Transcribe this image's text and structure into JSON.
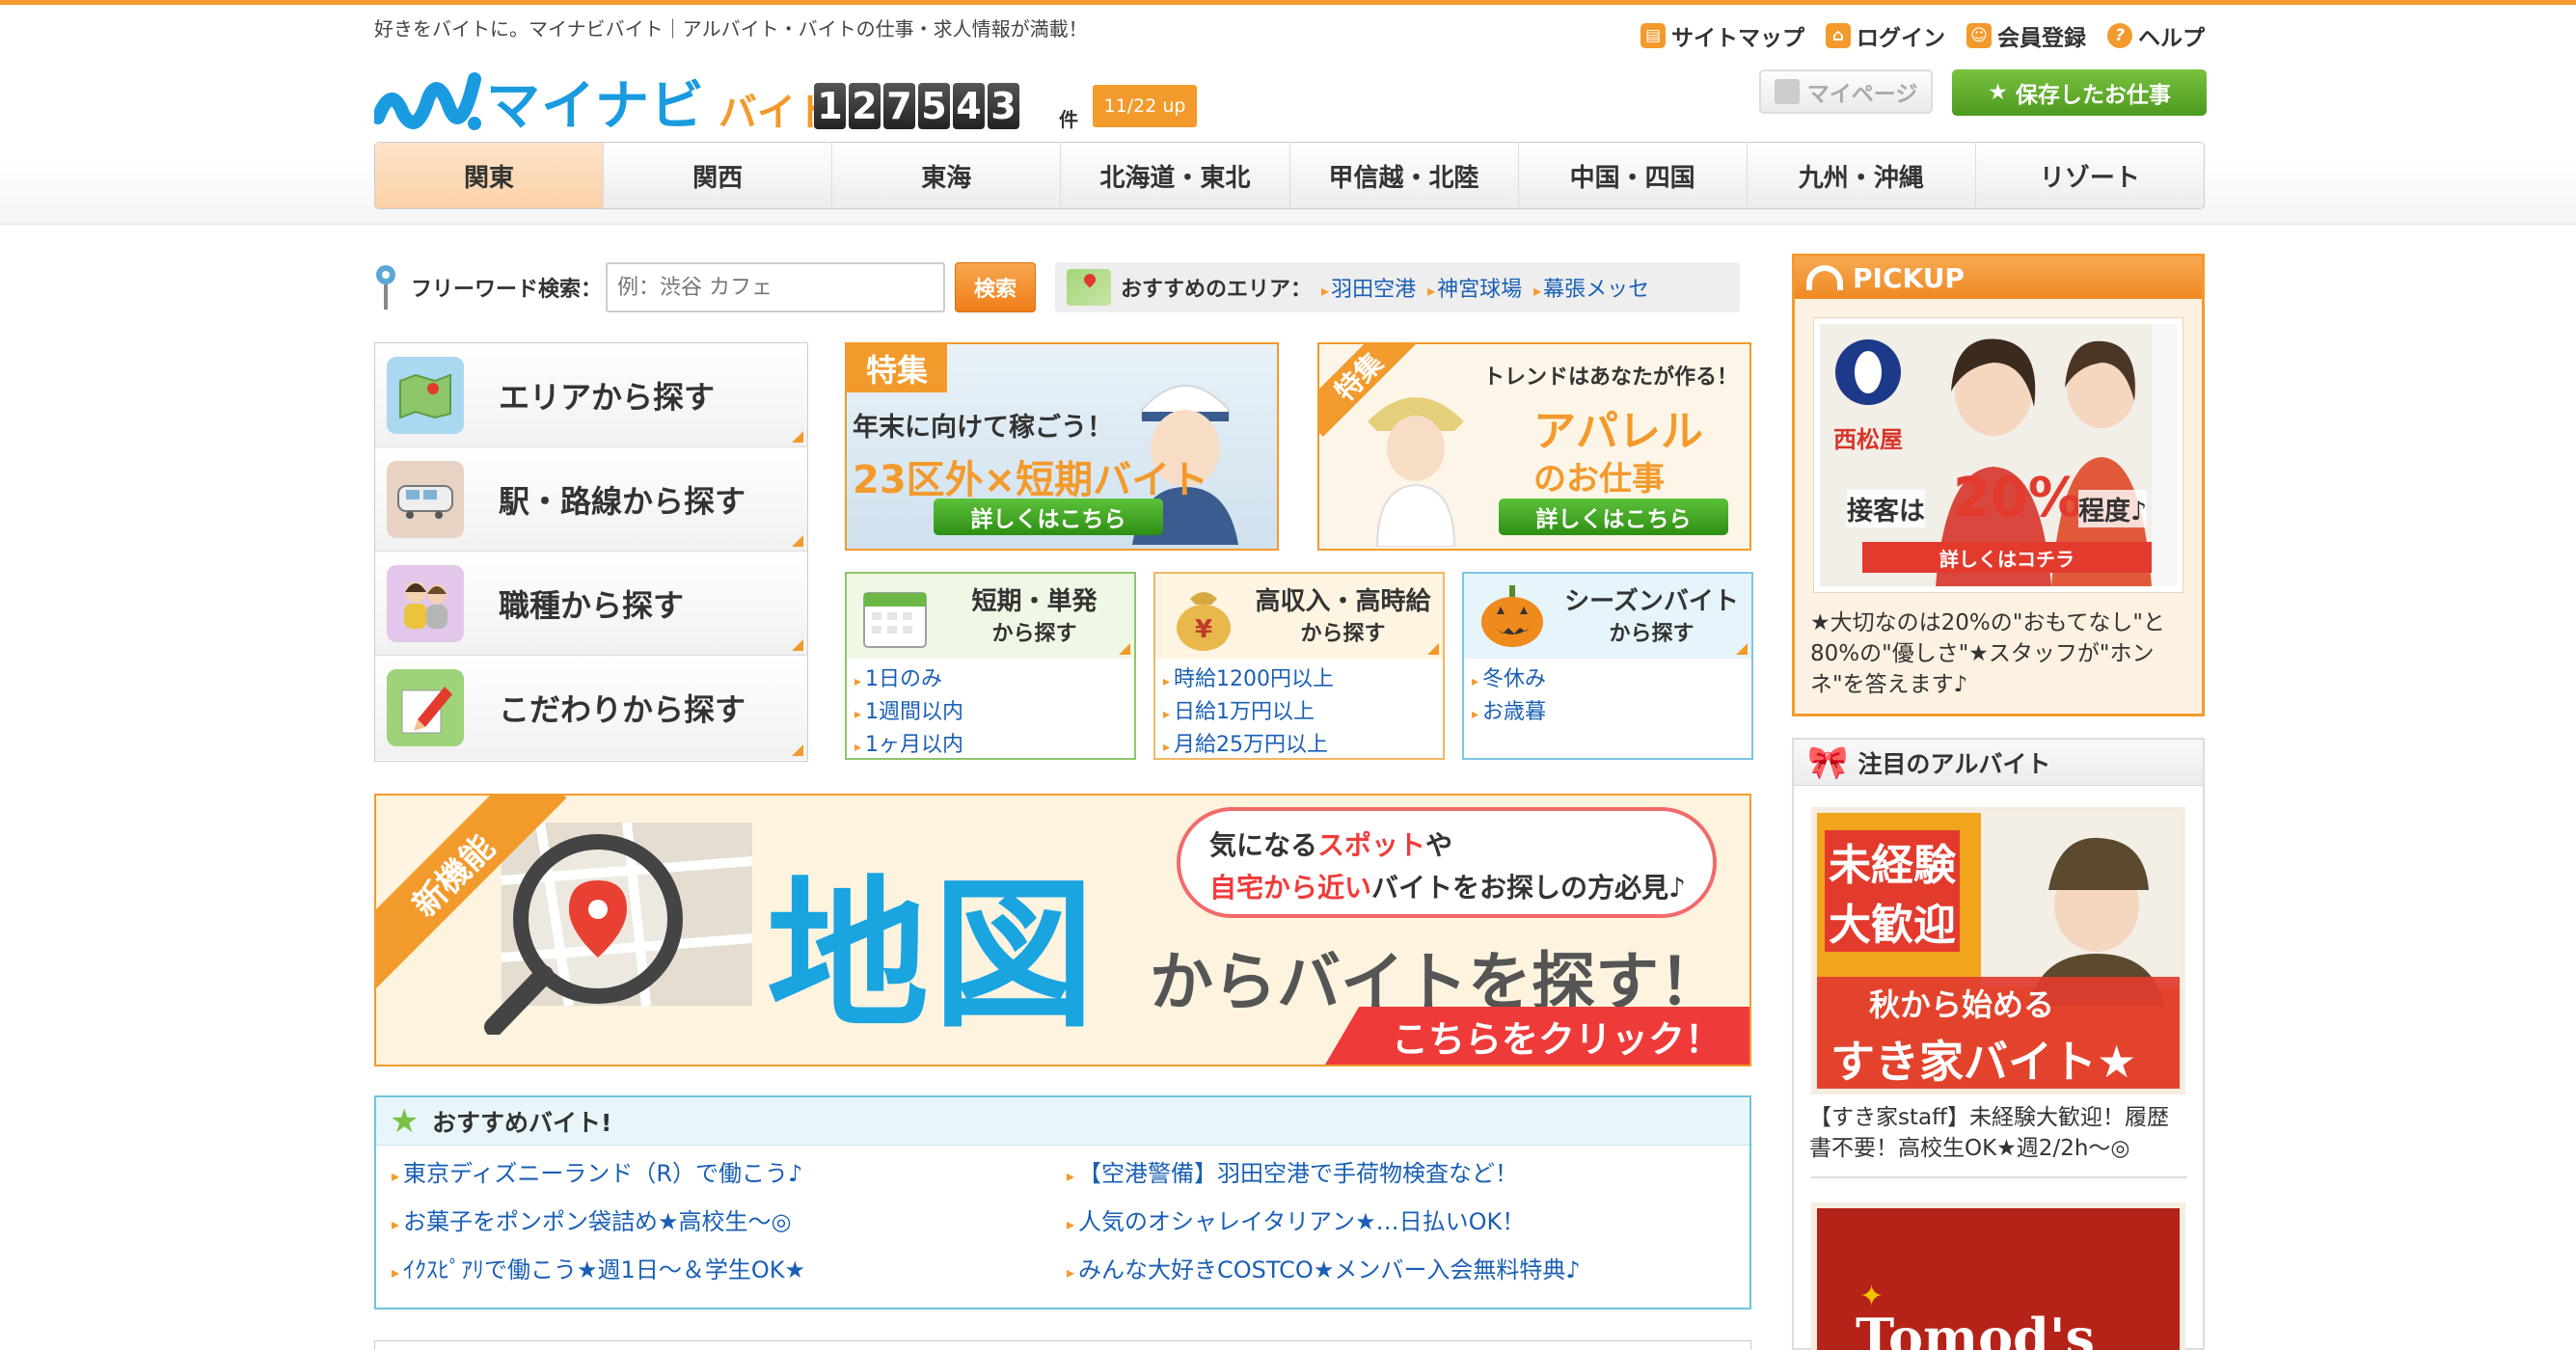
{
  "header": {
    "tagline": "好きをバイトに。マイナビバイト｜アルバイト・バイトの仕事・求人情報が満載！",
    "links": [
      {
        "label": "サイトマップ",
        "icon": "sitemap-icon"
      },
      {
        "label": "ログイン",
        "icon": "lock-icon"
      },
      {
        "label": "会員登録",
        "icon": "user-icon"
      },
      {
        "label": "ヘルプ",
        "icon": "help-icon"
      }
    ],
    "logo_text": "マイナビ",
    "logo_sub": "バイト",
    "count_digits": [
      "1",
      "2",
      "7",
      "5",
      "4",
      "3"
    ],
    "count_unit": "件",
    "update_badge": "11/22 up",
    "mypage_label": "マイページ",
    "saved_label": "保存したお仕事",
    "colors": {
      "accent": "#f39a2c",
      "brand_blue": "#1a9be0",
      "green": "#5cb82f"
    }
  },
  "nav": {
    "regions": [
      "関東",
      "関西",
      "東海",
      "北海道・東北",
      "甲信越・北陸",
      "中国・四国",
      "九州・沖縄",
      "リゾート"
    ],
    "active": "関東"
  },
  "search": {
    "label": "フリーワード検索：",
    "placeholder": "例：渋谷 カフェ",
    "button": "検索",
    "rec_label": "おすすめのエリア：",
    "rec_areas": [
      "羽田空港",
      "神宮球場",
      "幕張メッセ"
    ]
  },
  "finder": [
    {
      "label": "エリアから探す",
      "icon": "map-icon"
    },
    {
      "label": "駅・路線から探す",
      "icon": "train-icon"
    },
    {
      "label": "職種から探す",
      "icon": "people-icon"
    },
    {
      "label": "こだわりから探す",
      "icon": "pen-icon"
    }
  ],
  "tokushu": {
    "tag": "特集",
    "sub": "年末に向けて稼ごう！",
    "main": "23区外×短期バイト",
    "button": "詳しくはこちら"
  },
  "apparel": {
    "tag": "特集",
    "trend": "トレンドはあなたが作る！",
    "main": "アパレル",
    "main2": "のお仕事",
    "button": "詳しくはこちら"
  },
  "categories": [
    {
      "title": "短期・単発",
      "subtitle": "から探す",
      "icon": "calendar-icon",
      "items": [
        "1日のみ",
        "1週間以内",
        "1ヶ月以内"
      ]
    },
    {
      "title": "高収入・高時給",
      "subtitle": "から探す",
      "icon": "money-bag-icon",
      "items": [
        "時給1200円以上",
        "日給1万円以上",
        "月給25万円以上"
      ]
    },
    {
      "title": "シーズンバイト",
      "subtitle": "から探す",
      "icon": "pumpkin-icon",
      "items": [
        "冬休み",
        "お歳暮"
      ]
    }
  ],
  "map_banner": {
    "new_tag": "新機能",
    "big": "地図",
    "sub": "からバイトを探す！",
    "bubble_l1_a": "気になる",
    "bubble_l1_b": "スポット",
    "bubble_l1_c": "や",
    "bubble_l2_a": "自宅から近い",
    "bubble_l2_b": "バイトをお探しの方必見♪",
    "cta": "こちらをクリック！"
  },
  "osusume": {
    "title": "おすすめバイト!",
    "items": [
      "東京ディズニーランド（R）で働こう♪",
      "【空港警備】羽田空港で手荷物検査など！",
      "お菓子をポンポン袋詰め★高校生〜◎",
      "人気のオシャレイタリアン★…日払いOK！",
      "ｲｸｽﾋﾟｱﾘで働こう★週1日〜＆学生OK★",
      "みんな大好きCOSTCO★メンバー入会無料特典♪"
    ]
  },
  "pickup": {
    "title": "PICKUP",
    "brand": "西松屋",
    "img_line": "接客は",
    "img_pct": "20%",
    "img_line2": "程度♪",
    "img_btn": "詳しくはコチラ",
    "text": "★大切なのは20%の\"おもてなし\"と80%の\"優しさ\"★スタッフが\"ホンネ\"を答えます♪"
  },
  "chumoku": {
    "title": "注目のアルバイト",
    "sukiya_l1": "未経験",
    "sukiya_l2": "大歓迎",
    "sukiya_l3": "秋から始める",
    "sukiya_l4": "すき家バイト★",
    "text": "【すき家staff】未経験大歓迎！履歴書不要！高校生OK★週2/2h〜◎",
    "tomods": "Tomod's"
  }
}
